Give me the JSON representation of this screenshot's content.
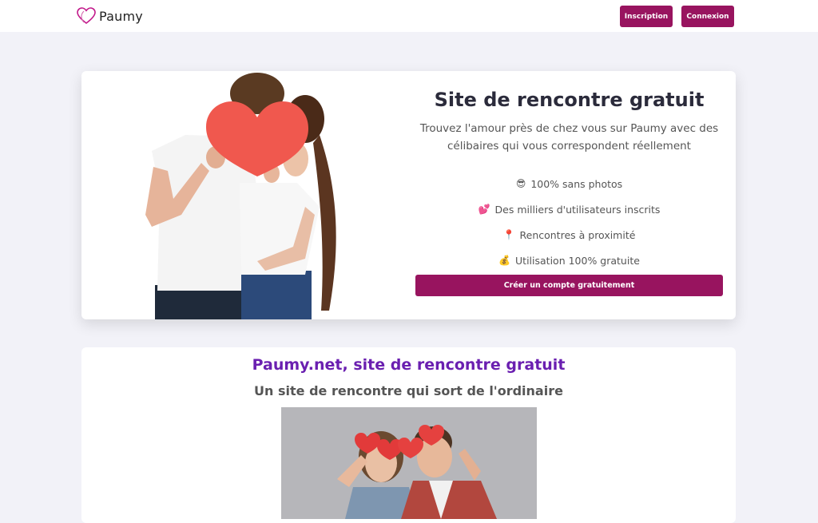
{
  "header": {
    "brand_name": "Paumy",
    "signup_label": "Inscription",
    "login_label": "Connexion"
  },
  "hero": {
    "title": "Site de rencontre gratuit",
    "subtitle": "Trouvez l'amour près de chez vous sur Paumy avec des célibaires qui vous correspondent réellement",
    "features": [
      {
        "emoji": "😎",
        "label": "100% sans photos"
      },
      {
        "emoji": "💕",
        "label": "Des milliers d'utilisateurs inscrits"
      },
      {
        "emoji": "📍",
        "label": "Rencontres à proximité"
      },
      {
        "emoji": "💰",
        "label": "Utilisation 100% gratuite"
      }
    ],
    "cta_label": "Créer un compte gratuitement"
  },
  "info": {
    "title": "Paumy.net, site de rencontre gratuit",
    "subtitle": "Un site de rencontre qui sort de l'ordinaire"
  },
  "colors": {
    "brand": "#98145f",
    "accent_title": "#6a1fb0",
    "background": "#f2f2f8"
  }
}
